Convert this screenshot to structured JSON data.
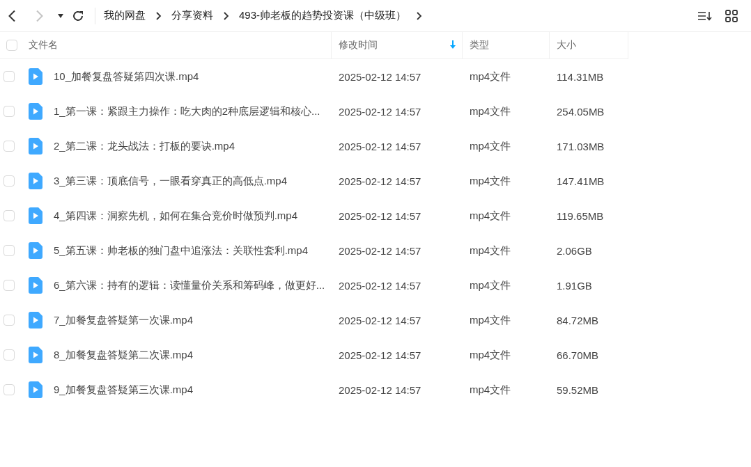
{
  "nav": [
    {
      "kind": "back",
      "disabled": false
    },
    {
      "kind": "forward",
      "disabled": true
    },
    {
      "kind": "dropdown",
      "disabled": false
    },
    {
      "kind": "refresh",
      "disabled": false
    }
  ],
  "breadcrumb": [
    "我的网盘",
    "分享资料",
    "493-帅老板的趋势投资课（中级班）"
  ],
  "columns": [
    {
      "label": "文件名",
      "sorted": false
    },
    {
      "label": "修改时间",
      "sorted": true
    },
    {
      "label": "类型",
      "sorted": false
    },
    {
      "label": "大小",
      "sorted": false
    }
  ],
  "select_all": {
    "checked": false
  },
  "files": [
    {
      "name": "10_加餐复盘答疑第四次课.mp4",
      "modified": "2025-02-12 14:57",
      "type": "mp4文件",
      "size": "114.31MB",
      "checked": false
    },
    {
      "name": "1_第一课：紧跟主力操作：吃大肉的2种底层逻辑和核心...",
      "modified": "2025-02-12 14:57",
      "type": "mp4文件",
      "size": "254.05MB",
      "checked": false
    },
    {
      "name": "2_第二课：龙头战法：打板的要诀.mp4",
      "modified": "2025-02-12 14:57",
      "type": "mp4文件",
      "size": "171.03MB",
      "checked": false
    },
    {
      "name": "3_第三课：顶底信号，一眼看穿真正的高低点.mp4",
      "modified": "2025-02-12 14:57",
      "type": "mp4文件",
      "size": "147.41MB",
      "checked": false
    },
    {
      "name": "4_第四课：洞察先机，如何在集合竞价时做预判.mp4",
      "modified": "2025-02-12 14:57",
      "type": "mp4文件",
      "size": "119.65MB",
      "checked": false
    },
    {
      "name": "5_第五课：帅老板的独门盘中追涨法：关联性套利.mp4",
      "modified": "2025-02-12 14:57",
      "type": "mp4文件",
      "size": "2.06GB",
      "checked": false
    },
    {
      "name": "6_第六课：持有的逻辑：读懂量价关系和筹码峰，做更好...",
      "modified": "2025-02-12 14:57",
      "type": "mp4文件",
      "size": "1.91GB",
      "checked": false
    },
    {
      "name": "7_加餐复盘答疑第一次课.mp4",
      "modified": "2025-02-12 14:57",
      "type": "mp4文件",
      "size": "84.72MB",
      "checked": false
    },
    {
      "name": "8_加餐复盘答疑第二次课.mp4",
      "modified": "2025-02-12 14:57",
      "type": "mp4文件",
      "size": "66.70MB",
      "checked": false
    },
    {
      "name": "9_加餐复盘答疑第三次课.mp4",
      "modified": "2025-02-12 14:57",
      "type": "mp4文件",
      "size": "59.52MB",
      "checked": false
    }
  ]
}
